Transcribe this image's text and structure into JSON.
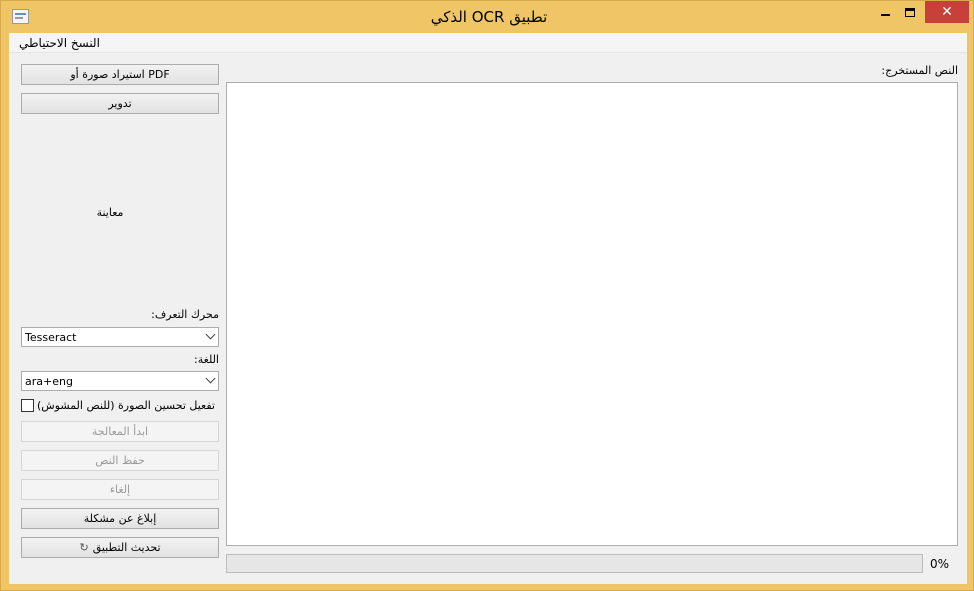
{
  "window": {
    "title": "الذكي OCR تطبيق",
    "controls": {
      "minimize": "",
      "maximize": "",
      "close": "✕"
    }
  },
  "menu": {
    "items": [
      {
        "label": "النسخ الاحتياطي"
      }
    ]
  },
  "sidebar": {
    "import_button": "PDF استيراد صورة أو",
    "rotate_button": "تدوير",
    "preview_label": "معاينة",
    "engine_label": "محرك التعرف:",
    "engine_value": "Tesseract",
    "language_label": "اللغة:",
    "language_value": "ara+eng",
    "enhance_checkbox": {
      "label": "تفعيل تحسين الصورة (للنص المشوش)",
      "checked": false
    },
    "start_button": "ابدأ المعالجة",
    "save_button": "حفظ النص",
    "cancel_button": "إلغاء",
    "report_button": "إبلاغ عن مشكلة",
    "update_button": "تحديث التطبيق"
  },
  "main": {
    "extracted_label": "النص المستخرج:",
    "extracted_text": ""
  },
  "progress": {
    "value": 0,
    "text": "0%"
  },
  "colors": {
    "title_bar": "#f0c566",
    "close_button": "#c7403a",
    "client_bg": "#f0f0f0"
  },
  "icons": {
    "app": "app-window-icon",
    "refresh": "refresh-icon"
  }
}
